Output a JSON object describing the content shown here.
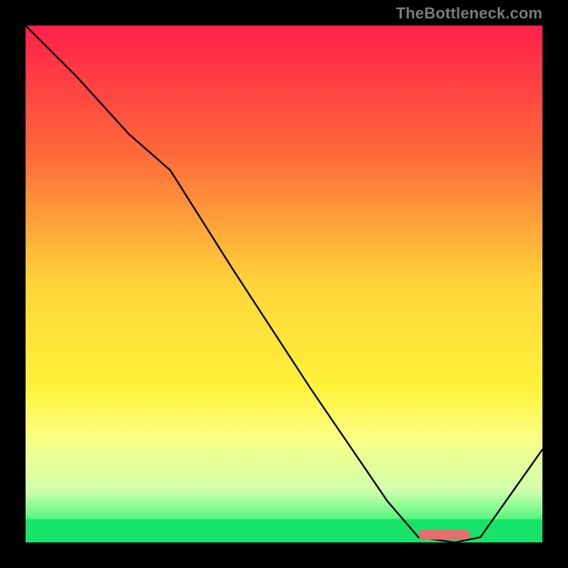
{
  "watermark": "TheBottleneck.com",
  "chart_data": {
    "type": "line",
    "title": "",
    "xlabel": "",
    "ylabel": "",
    "xlim": [
      0,
      100
    ],
    "ylim": [
      0,
      100
    ],
    "series": [
      {
        "name": "curve",
        "x": [
          0,
          10,
          20,
          28,
          40,
          55,
          70,
          76,
          83,
          88,
          100
        ],
        "y": [
          100,
          90,
          79,
          72,
          53,
          30,
          8,
          1,
          0,
          1,
          18
        ]
      }
    ],
    "marker": {
      "x_start": 76,
      "x_end": 86,
      "y": 1.5
    },
    "gradient_stops": [
      {
        "pct": 0,
        "color": "#ff1f4b"
      },
      {
        "pct": 25,
        "color": "#ff6a3a"
      },
      {
        "pct": 50,
        "color": "#ffd43a"
      },
      {
        "pct": 70,
        "color": "#fff23a"
      },
      {
        "pct": 80,
        "color": "#fbff86"
      },
      {
        "pct": 90,
        "color": "#cfffad"
      },
      {
        "pct": 96,
        "color": "#4cf57a"
      },
      {
        "pct": 100,
        "color": "#0fdc62"
      }
    ],
    "green_band": {
      "from_pct": 95.5,
      "to_pct": 100
    }
  }
}
